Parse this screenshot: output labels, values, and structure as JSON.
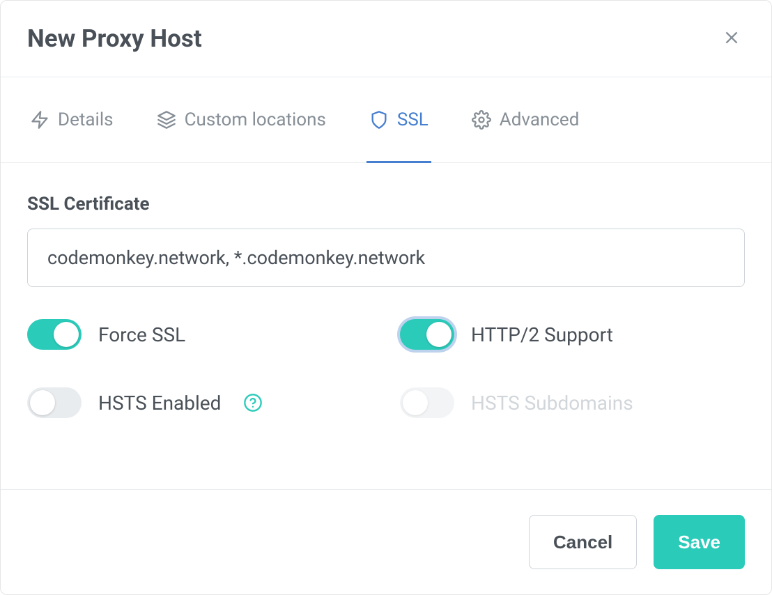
{
  "header": {
    "title": "New Proxy Host"
  },
  "tabs": {
    "details": "Details",
    "custom_locations": "Custom locations",
    "ssl": "SSL",
    "advanced": "Advanced",
    "active": "ssl"
  },
  "ssl": {
    "label": "SSL Certificate",
    "value": "codemonkey.network, *.codemonkey.network",
    "switches": {
      "force_ssl": {
        "label": "Force SSL",
        "on": true,
        "focused": false,
        "disabled": false
      },
      "http2": {
        "label": "HTTP/2 Support",
        "on": true,
        "focused": true,
        "disabled": false
      },
      "hsts": {
        "label": "HSTS Enabled",
        "on": false,
        "focused": false,
        "disabled": false,
        "help": true
      },
      "hsts_sub": {
        "label": "HSTS Subdomains",
        "on": false,
        "focused": false,
        "disabled": true
      }
    }
  },
  "footer": {
    "cancel": "Cancel",
    "save": "Save"
  }
}
